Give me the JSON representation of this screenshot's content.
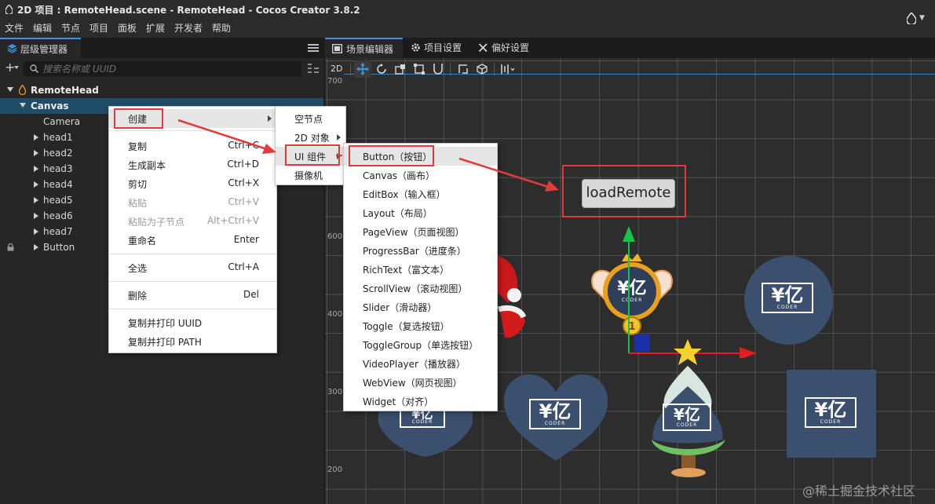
{
  "window": {
    "title": "2D 项目 : RemoteHead.scene - RemoteHead - Cocos Creator 3.8.2",
    "icon": "cocos-logo-icon"
  },
  "menubar": [
    "文件",
    "编辑",
    "节点",
    "项目",
    "面板",
    "扩展",
    "开发者",
    "帮助"
  ],
  "hierarchy": {
    "tab_label": "层级管理器",
    "search_placeholder": "搜索名称或 UUID",
    "tree": [
      {
        "label": "RemoteHead",
        "expanded": true
      },
      {
        "label": "Canvas",
        "expanded": true,
        "selected": true
      },
      {
        "label": "Camera"
      },
      {
        "label": "head1"
      },
      {
        "label": "head2"
      },
      {
        "label": "head3"
      },
      {
        "label": "head4"
      },
      {
        "label": "head5"
      },
      {
        "label": "head6"
      },
      {
        "label": "head7"
      },
      {
        "label": "Button",
        "locked": true
      }
    ]
  },
  "scene_tabs": [
    "场景编辑器",
    "项目设置",
    "偏好设置"
  ],
  "scene": {
    "mode_2d": "2D",
    "ruler_labels": [
      "700",
      "600",
      "400",
      "300",
      "200"
    ],
    "load_button_label": "loadRemote",
    "logo_text": "¥亿",
    "logo_subtext": "CODER",
    "badge_number": "1"
  },
  "context_menu": {
    "items": [
      {
        "label": "创建",
        "shortcut": "",
        "submenu": true,
        "highlighted": true
      },
      {
        "label": "复制",
        "shortcut": "Ctrl+C"
      },
      {
        "label": "生成副本",
        "shortcut": "Ctrl+D"
      },
      {
        "label": "剪切",
        "shortcut": "Ctrl+X"
      },
      {
        "label": "粘贴",
        "shortcut": "Ctrl+V",
        "disabled": true
      },
      {
        "label": "粘贴为子节点",
        "shortcut": "Alt+Ctrl+V",
        "disabled": true
      },
      {
        "label": "重命名",
        "shortcut": "Enter"
      },
      {
        "label": "全选",
        "shortcut": "Ctrl+A"
      },
      {
        "label": "删除",
        "shortcut": "Del"
      },
      {
        "label": "复制并打印 UUID",
        "shortcut": ""
      },
      {
        "label": "复制并打印 PATH",
        "shortcut": ""
      }
    ]
  },
  "create_submenu": {
    "items": [
      {
        "label": "空节点"
      },
      {
        "label": "2D 对象",
        "submenu": true
      },
      {
        "label": "UI 组件",
        "submenu": true,
        "highlighted": true
      },
      {
        "label": "摄像机"
      }
    ]
  },
  "ui_submenu": {
    "items": [
      "Button（按钮）",
      "Canvas（画布）",
      "EditBox（输入框）",
      "Layout（布局）",
      "PageView（页面视图）",
      "ProgressBar（进度条）",
      "RichText（富文本）",
      "ScrollView（滚动视图）",
      "Slider（滑动器）",
      "Toggle（复选按钮）",
      "ToggleGroup（单选按钮）",
      "VideoPlayer（播放器）",
      "WebView（网页视图）",
      "Widget（对齐）"
    ]
  },
  "colors": {
    "accent": "#3a95d6",
    "highlight_box": "#e23b3b",
    "selected_row": "#1f4c68",
    "logo_bg": "#3b4f6e"
  },
  "watermark": "@稀土掘金技术社区"
}
